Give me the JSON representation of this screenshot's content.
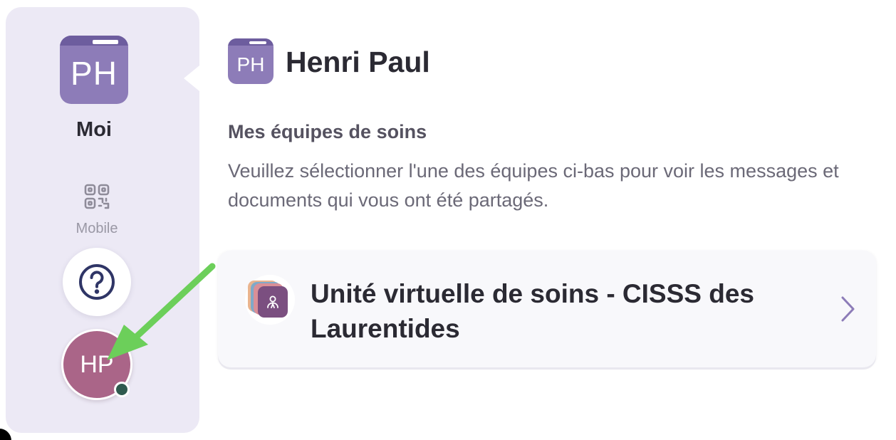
{
  "sidebar": {
    "me": {
      "initials": "PH",
      "label": "Moi"
    },
    "mobile": {
      "label": "Mobile",
      "icon": "qr-code-icon"
    },
    "help": {
      "icon": "question-circle-icon"
    },
    "avatar": {
      "initials": "HP",
      "status": "online"
    }
  },
  "header": {
    "initials": "PH",
    "name": "Henri Paul"
  },
  "section": {
    "title": "Mes équipes de soins",
    "description": "Veuillez sélectionner l'une des équipes ci-bas pour voir les messages et documents qui vous ont été partagés."
  },
  "teams": [
    {
      "name": "Unité virtuelle de soins - CISSS des Laurentides",
      "icon": "team-stack-icon"
    }
  ],
  "colors": {
    "sidebar_bg": "#ece9f5",
    "folder_purple": "#8d7cb8",
    "avatar_pink": "#aa6588",
    "presence_green": "#2f5a4f",
    "annotation_arrow": "#6ccf5a",
    "chevron": "#8d7cb8"
  }
}
